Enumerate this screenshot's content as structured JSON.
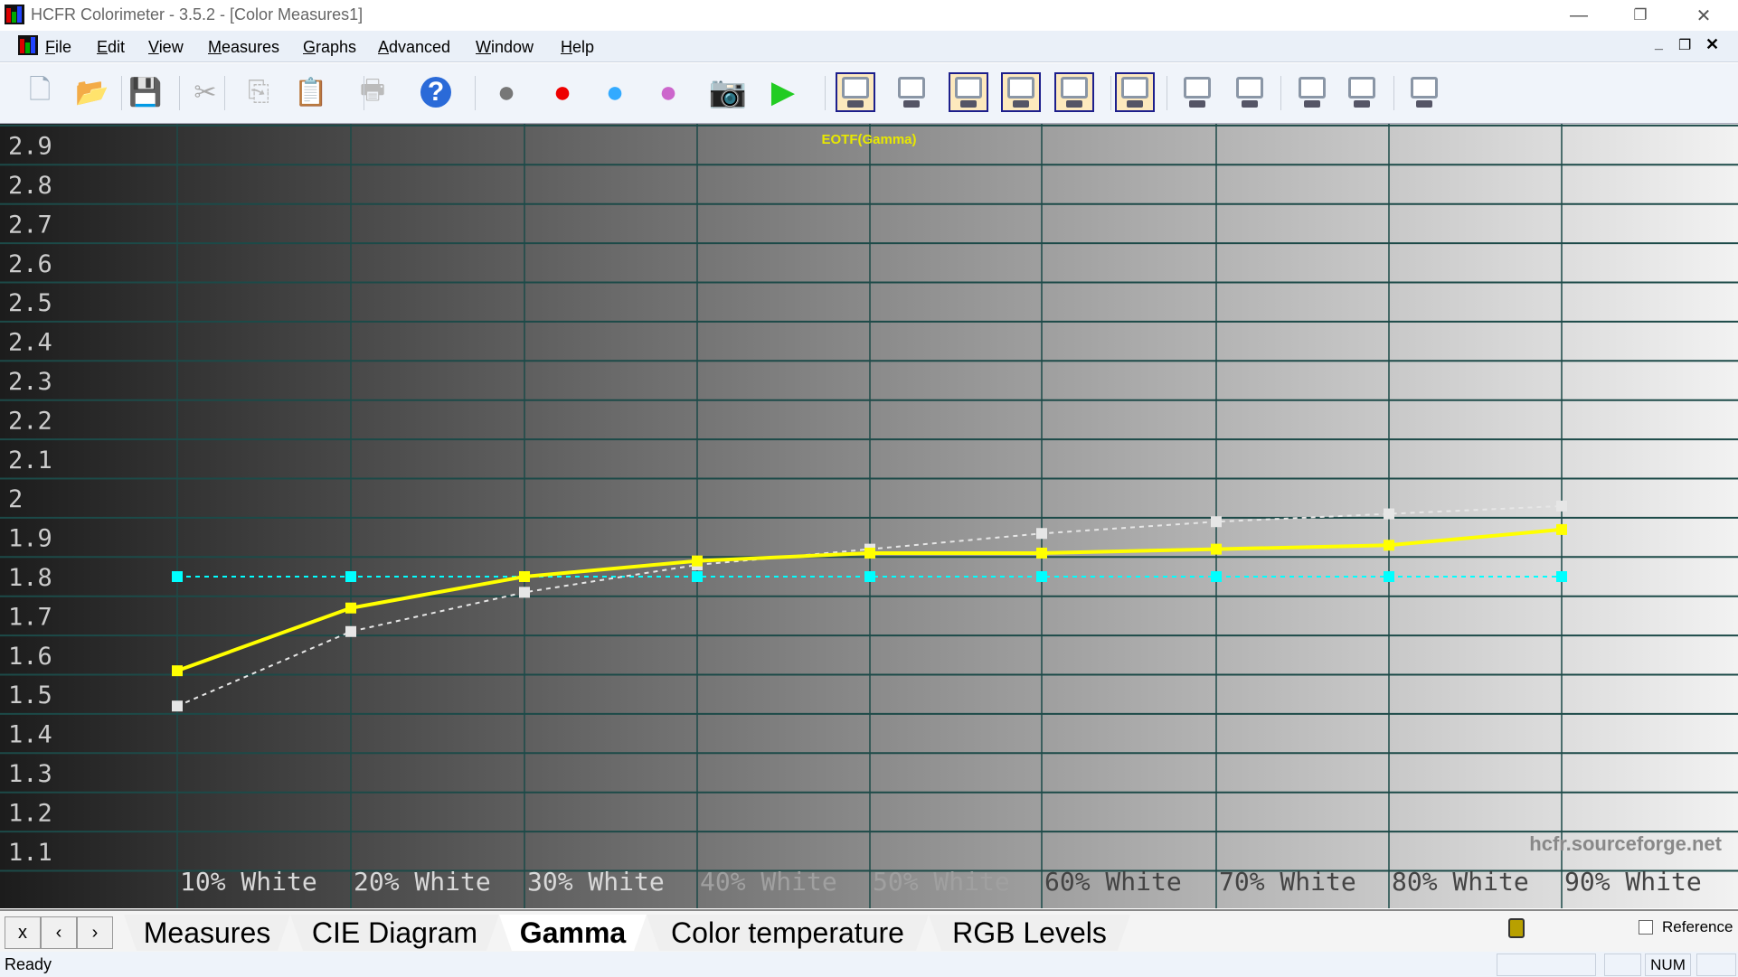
{
  "window": {
    "title": "HCFR Colorimeter - 3.5.2 - [Color Measures1]",
    "controls": [
      "minimize",
      "restore",
      "close"
    ]
  },
  "menu": [
    {
      "key": "F",
      "rest": "ile"
    },
    {
      "key": "E",
      "rest": "dit"
    },
    {
      "key": "V",
      "rest": "iew"
    },
    {
      "key": "M",
      "rest": "easures"
    },
    {
      "key": "G",
      "rest": "raphs"
    },
    {
      "key": "A",
      "rest": "dvanced"
    },
    {
      "key": "W",
      "rest": "indow"
    },
    {
      "key": "H",
      "rest": "elp"
    }
  ],
  "toolbar": {
    "file_tools": [
      "new-document",
      "open-folder",
      "save-disk",
      "cut-scissors",
      "copy",
      "paste",
      "print",
      "help"
    ],
    "measure_tools": [
      "measure-grayscale",
      "measure-primaries",
      "measure-secondaries",
      "measure-saturation",
      "capture-camera",
      "run-play"
    ],
    "graph_views": [
      {
        "icon": "measures-view",
        "active": true
      },
      {
        "icon": "luminance-view",
        "active": false
      },
      {
        "icon": "gamma-view",
        "active": true
      },
      {
        "icon": "rgb-levels-view",
        "active": true
      },
      {
        "icon": "color-temperature-view",
        "active": true
      },
      {
        "icon": "cie-diagram-view",
        "active": true
      },
      {
        "icon": "near-black-view",
        "active": false
      },
      {
        "icon": "near-white-view",
        "active": false
      },
      {
        "icon": "saturation-luminance-view",
        "active": false
      },
      {
        "icon": "saturation-shift-view",
        "active": false
      },
      {
        "icon": "measures-combo-view",
        "active": false
      }
    ]
  },
  "chart_data": {
    "type": "line",
    "title": "EOTF(Gamma)",
    "watermark": "hcfr.sourceforge.net",
    "categories": [
      "10% White",
      "20% White",
      "30% White",
      "40% White",
      "50% White",
      "60% White",
      "70% White",
      "80% White",
      "90% White"
    ],
    "yticks": [
      "2.9",
      "2.8",
      "2.7",
      "2.6",
      "2.5",
      "2.4",
      "2.3",
      "2.2",
      "2.1",
      "2",
      "1.9",
      "1.8",
      "1.7",
      "1.6",
      "1.5",
      "1.4",
      "1.3",
      "1.2",
      "1.1"
    ],
    "ylim": [
      1.05,
      2.95
    ],
    "grid": true,
    "series": [
      {
        "color": "#ffff00",
        "style": "solid",
        "values": [
          1.56,
          1.72,
          1.8,
          1.84,
          1.86,
          1.86,
          1.87,
          1.88,
          1.92
        ]
      },
      {
        "color": "#e6e6e6",
        "style": "dotted",
        "values": [
          1.47,
          1.66,
          1.76,
          1.83,
          1.87,
          1.91,
          1.94,
          1.96,
          1.98
        ]
      },
      {
        "color": "#00ffff",
        "style": "dotted",
        "values": [
          1.8,
          1.8,
          1.8,
          1.8,
          1.8,
          1.8,
          1.8,
          1.8,
          1.8
        ]
      }
    ]
  },
  "tabs": {
    "nav": [
      "x",
      "‹",
      "›"
    ],
    "items": [
      "Measures",
      "CIE Diagram",
      "Gamma",
      "Color temperature",
      "RGB Levels"
    ],
    "active": 2,
    "reference_label": "Reference",
    "reference_checked": false
  },
  "status": {
    "text": "Ready",
    "num": "NUM"
  }
}
